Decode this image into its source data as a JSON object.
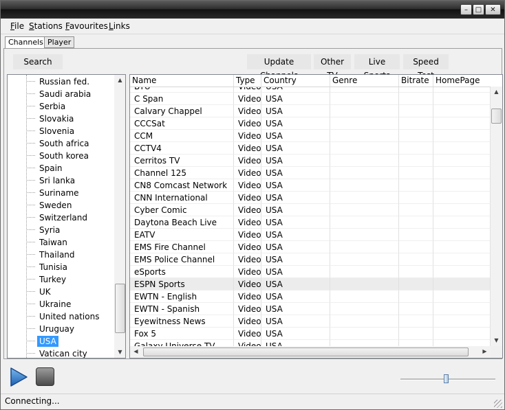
{
  "window": {
    "buttons": {
      "minimize": "–",
      "maximize": "□",
      "close": "✕"
    }
  },
  "menu": [
    {
      "label": "File",
      "mnemonic": "F",
      "rest": "ile"
    },
    {
      "label": "Stations",
      "mnemonic": "S",
      "rest": "tations"
    },
    {
      "label": "Favourites",
      "mnemonic": "F",
      "rest": "avourites"
    },
    {
      "label": "Links",
      "mnemonic": "L",
      "rest": "inks"
    }
  ],
  "tabs": [
    {
      "label": "Channels",
      "active": true
    },
    {
      "label": "Player",
      "active": false
    }
  ],
  "toolbar": {
    "search": "Search",
    "update_channels": "Update Channels",
    "other_tv": "Other TV",
    "live_sports": "Live Sports",
    "speed_test": "Speed Test"
  },
  "tree": {
    "items": [
      "Russian fed.",
      "Saudi arabia",
      "Serbia",
      "Slovakia",
      "Slovenia",
      "South africa",
      "South korea",
      "Spain",
      "Sri lanka",
      "Suriname",
      "Sweden",
      "Switzerland",
      "Syria",
      "Taiwan",
      "Thailand",
      "Tunisia",
      "Turkey",
      "UK",
      "Ukraine",
      "United nations",
      "Uruguay",
      "USA",
      "Vatican city"
    ],
    "selected": "USA"
  },
  "grid": {
    "columns": [
      "Name",
      "Type",
      "Country",
      "Genre",
      "Bitrate",
      "HomePage"
    ],
    "rows": [
      [
        "BYU",
        "Video",
        "USA",
        "",
        "",
        ""
      ],
      [
        "C Span",
        "Video",
        "USA",
        "",
        "",
        ""
      ],
      [
        "Calvary Chappel",
        "Video",
        "USA",
        "",
        "",
        ""
      ],
      [
        "CCCSat",
        "Video",
        "USA",
        "",
        "",
        ""
      ],
      [
        "CCM",
        "Video",
        "USA",
        "",
        "",
        ""
      ],
      [
        "CCTV4",
        "Video",
        "USA",
        "",
        "",
        ""
      ],
      [
        "Cerritos TV",
        "Video",
        "USA",
        "",
        "",
        ""
      ],
      [
        "Channel 125",
        "Video",
        "USA",
        "",
        "",
        ""
      ],
      [
        "CN8 Comcast Network",
        "Video",
        "USA",
        "",
        "",
        ""
      ],
      [
        "CNN International",
        "Video",
        "USA",
        "",
        "",
        ""
      ],
      [
        "Cyber Comic",
        "Video",
        "USA",
        "",
        "",
        ""
      ],
      [
        "Daytona Beach Live",
        "Video",
        "USA",
        "",
        "",
        ""
      ],
      [
        "EATV",
        "Video",
        "USA",
        "",
        "",
        ""
      ],
      [
        "EMS Fire Channel",
        "Video",
        "USA",
        "",
        "",
        ""
      ],
      [
        "EMS Police Channel",
        "Video",
        "USA",
        "",
        "",
        ""
      ],
      [
        "eSports",
        "Video",
        "USA",
        "",
        "",
        ""
      ],
      [
        "ESPN Sports",
        "Video",
        "USA",
        "",
        "",
        ""
      ],
      [
        "EWTN - English",
        "Video",
        "USA",
        "",
        "",
        ""
      ],
      [
        "EWTN - Spanish",
        "Video",
        "USA",
        "",
        "",
        ""
      ],
      [
        "Eyewitness News",
        "Video",
        "USA",
        "",
        "",
        ""
      ],
      [
        "Fox 5",
        "Video",
        "USA",
        "",
        "",
        ""
      ],
      [
        "Galaxy Universe TV",
        "Video",
        "USA",
        "",
        "",
        ""
      ]
    ],
    "highlighted_row": "ESPN Sports"
  },
  "player": {
    "volume_level": 0.48
  },
  "status": {
    "text": "Connecting..."
  }
}
